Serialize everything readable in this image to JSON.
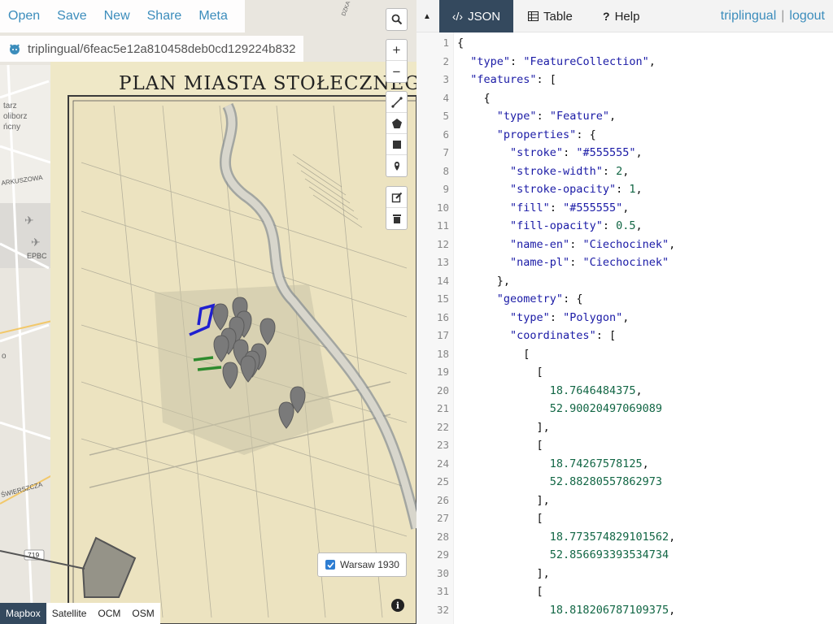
{
  "menu": {
    "open": "Open",
    "save": "Save",
    "new": "New",
    "share": "Share",
    "meta": "Meta"
  },
  "gist": {
    "path": "triplingual/6feac5e12a810458deb0cd129224b832",
    "icon": "github-octocat-icon"
  },
  "map_controls": {
    "search_icon": "search-icon",
    "zoom_in": "+",
    "zoom_out": "−",
    "draw_tools": [
      "line-icon",
      "polygon-icon",
      "rectangle-icon",
      "marker-icon"
    ],
    "edit_tools": [
      "edit-icon",
      "trash-icon"
    ]
  },
  "map": {
    "title": "PLAN MIASTA STOŁECZNEGO W",
    "labels": {
      "starz": "tarz",
      "zoliborz": "oliborz",
      "cny": "ńcny",
      "arkuszowa": "ARKUSZOWA",
      "epbc": "EPBC",
      "swierszcza": "ŚWIERSZCZA",
      "road": "719",
      "dzka": "DZKA",
      "left_o": "o"
    }
  },
  "layer_toggle": {
    "label": "Warsaw 1930",
    "checked": true
  },
  "info": "i",
  "basemaps": [
    "Mapbox",
    "Satellite",
    "OCM",
    "OSM"
  ],
  "basemap_active": "Mapbox",
  "tabs": [
    {
      "label": "JSON",
      "icon": "code-icon",
      "active": true
    },
    {
      "label": "Table",
      "icon": "table-icon",
      "active": false
    },
    {
      "label": "Help",
      "icon": "help-icon",
      "active": false
    }
  ],
  "user": {
    "name": "triplingual",
    "sep": "|",
    "logout": "logout"
  },
  "editor_lines": [
    "{",
    "  \"type\": \"FeatureCollection\",",
    "  \"features\": [",
    "    {",
    "      \"type\": \"Feature\",",
    "      \"properties\": {",
    "        \"stroke\": \"#555555\",",
    "        \"stroke-width\": 2,",
    "        \"stroke-opacity\": 1,",
    "        \"fill\": \"#555555\",",
    "        \"fill-opacity\": 0.5,",
    "        \"name-en\": \"Ciechocinek\",",
    "        \"name-pl\": \"Ciechocinek\"",
    "      },",
    "      \"geometry\": {",
    "        \"type\": \"Polygon\",",
    "        \"coordinates\": [",
    "          [",
    "            [",
    "              18.7646484375,",
    "              52.90020497069089",
    "            ],",
    "            [",
    "              18.74267578125,",
    "              52.88280557862973",
    "            ],",
    "            [",
    "              18.773574829101562,",
    "              52.856693393534734",
    "            ],",
    "            [",
    "              18.818206787109375,"
  ],
  "colors": {
    "accent": "#3c8dbc",
    "active_tab": "#34495e",
    "json_key": "#1a1aa6",
    "json_number": "#116644"
  }
}
